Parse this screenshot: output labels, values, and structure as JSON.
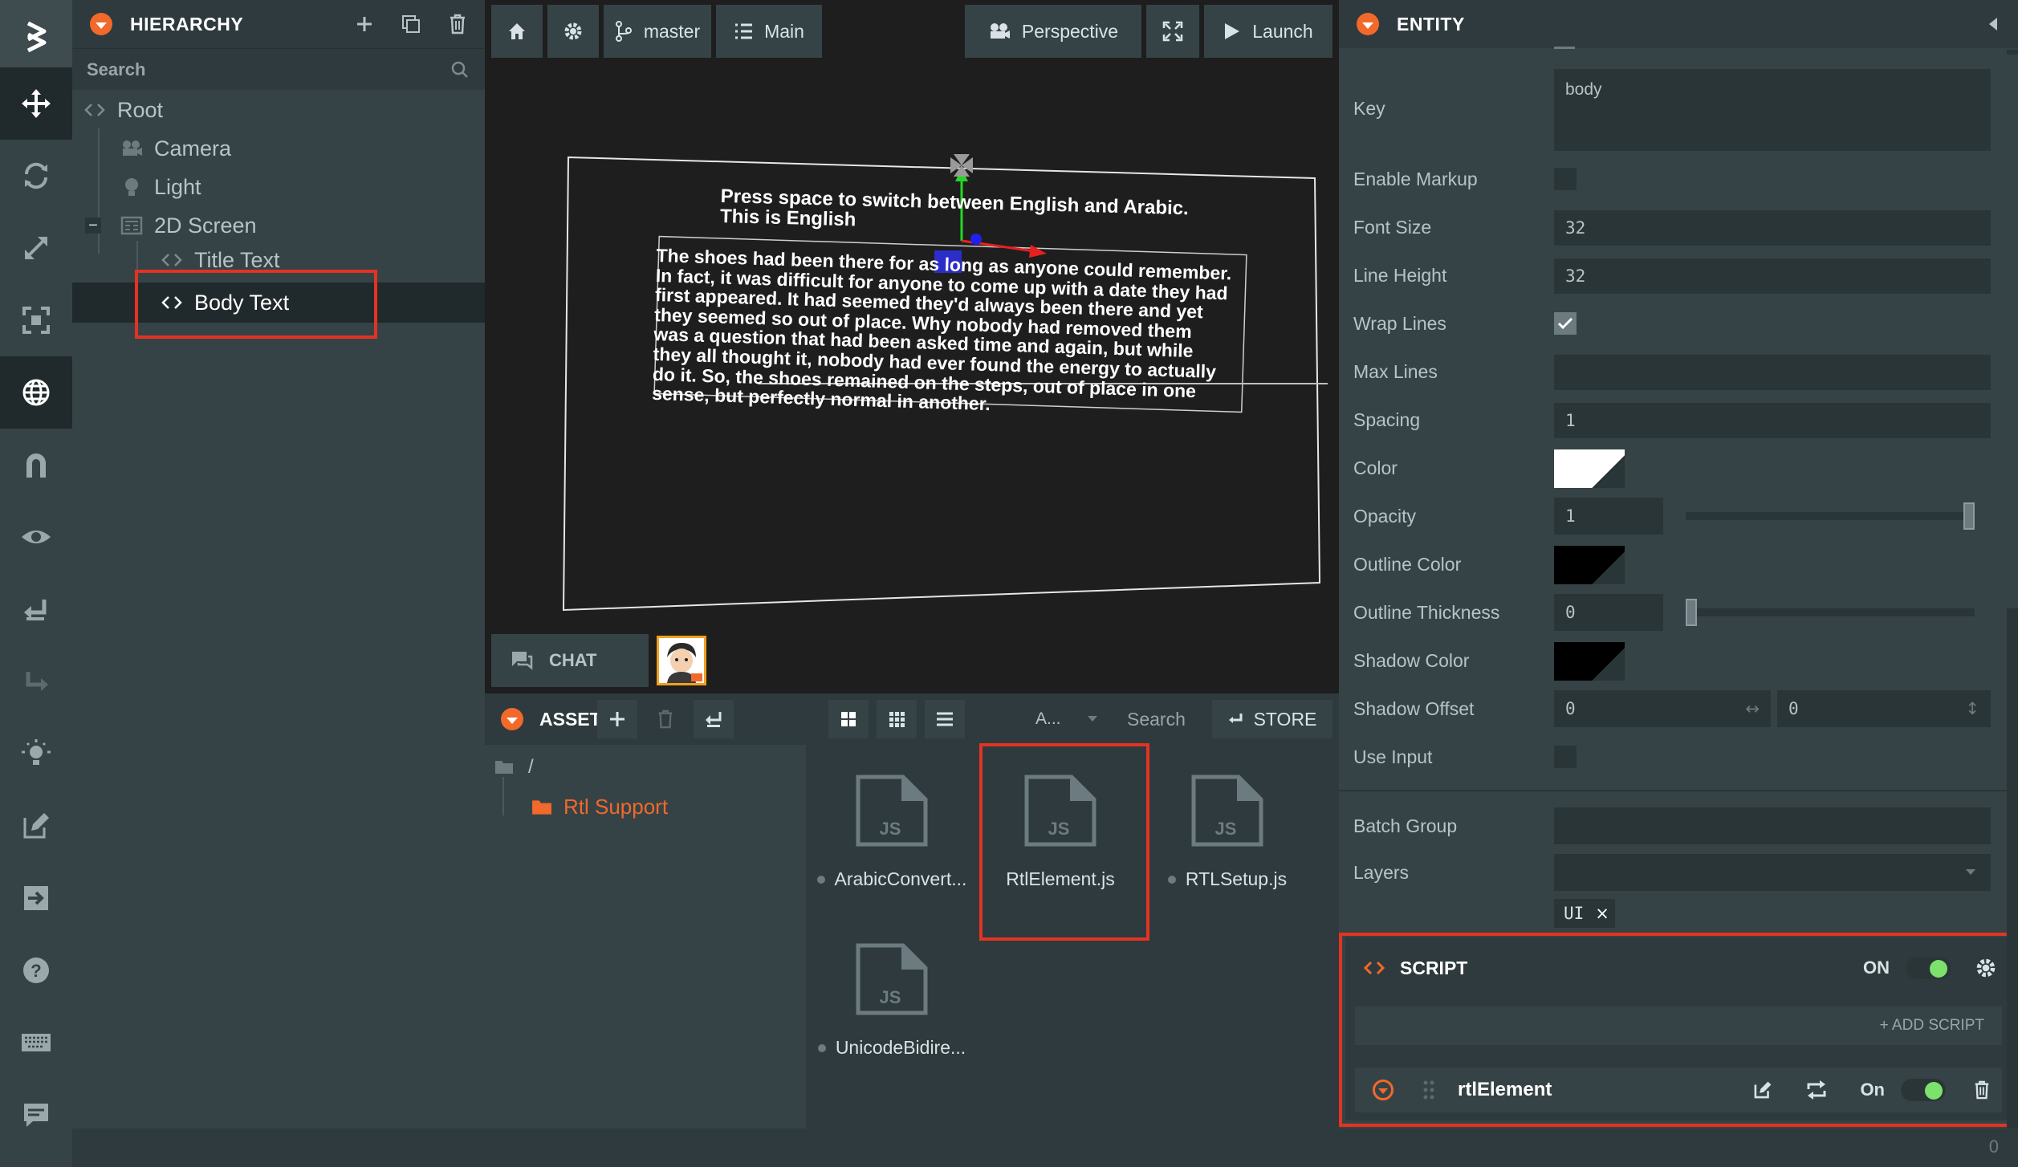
{
  "toolbar": {
    "tools": [
      "logo-icon",
      "translate-icon",
      "rotate-icon",
      "scale-icon",
      "resize-icon",
      "world-icon",
      "snap-icon",
      "view-icon",
      "undo-icon",
      "redo-icon",
      "light-icon",
      "edit-icon",
      "publish-icon",
      "help-icon",
      "keyboard-icon",
      "chat-icon"
    ]
  },
  "hierarchy": {
    "title": "HIERARCHY",
    "search_placeholder": "Search",
    "items": {
      "root": "Root",
      "camera": "Camera",
      "light": "Light",
      "screen": "2D Screen",
      "title_text": "Title Text",
      "body_text": "Body Text"
    }
  },
  "viewport": {
    "branch": "master",
    "scene": "Main",
    "camera": "Perspective",
    "launch": "Launch",
    "chat": "CHAT",
    "canvas": {
      "heading": "Press space to switch between English and Arabic.",
      "subheading": "This is English",
      "body_lines": [
        "The shoes had been there for as long as anyone could remember.",
        "In fact, it was difficult for anyone to come up with a date they had",
        "first appeared. It had seemed they'd always been there and yet",
        "they seemed so out of place. Why nobody had removed them",
        "was a question that had been asked time and again, but while",
        "they all thought it, nobody had ever found the energy to actually",
        "do it. So, the shoes remained on the steps, out of place in one",
        "sense, but perfectly normal in another."
      ]
    }
  },
  "assets": {
    "title": "ASSETS",
    "filter": "A...",
    "search_placeholder": "Search",
    "store": "STORE",
    "path_root": "/",
    "folder": "Rtl Support",
    "files": [
      {
        "name": "ArabicConvert...",
        "type": "JS"
      },
      {
        "name": "RtlElement.js",
        "type": "JS"
      },
      {
        "name": "RTLSetup.js",
        "type": "JS"
      },
      {
        "name": "UnicodeBidire...",
        "type": "JS"
      }
    ]
  },
  "entity": {
    "title": "ENTITY",
    "props": {
      "key_label": "Key",
      "key_value": "body",
      "markup_label": "Enable Markup",
      "font_size_label": "Font Size",
      "font_size_value": "32",
      "line_height_label": "Line Height",
      "line_height_value": "32",
      "wrap_label": "Wrap Lines",
      "max_lines_label": "Max Lines",
      "max_lines_value": "",
      "spacing_label": "Spacing",
      "spacing_value": "1",
      "color_label": "Color",
      "opacity_label": "Opacity",
      "opacity_value": "1",
      "outline_color_label": "Outline Color",
      "outline_thickness_label": "Outline Thickness",
      "outline_thickness_value": "0",
      "shadow_color_label": "Shadow Color",
      "shadow_offset_label": "Shadow Offset",
      "shadow_offset_x": "0",
      "shadow_offset_y": "0",
      "use_input_label": "Use Input",
      "batch_group_label": "Batch Group",
      "layers_label": "Layers",
      "layer_tag": "UI",
      "layer_remove": "×"
    },
    "values": {
      "wrap_lines": true,
      "enable_markup": false,
      "use_input": false,
      "opacity": 1,
      "outline_thickness": 0
    },
    "script": {
      "title": "SCRIPT",
      "on_label": "ON",
      "add_script": "+ ADD SCRIPT",
      "script_name": "rtlElement",
      "script_on": "On"
    },
    "colors": {
      "color": "#ffffff",
      "outline_color": "#000000",
      "shadow_color": "#000000"
    }
  },
  "status": {
    "count": "0"
  },
  "theme": {
    "accent": "#f1692b",
    "highlight": "#e33322",
    "toggle_on": "#7ce26b"
  }
}
